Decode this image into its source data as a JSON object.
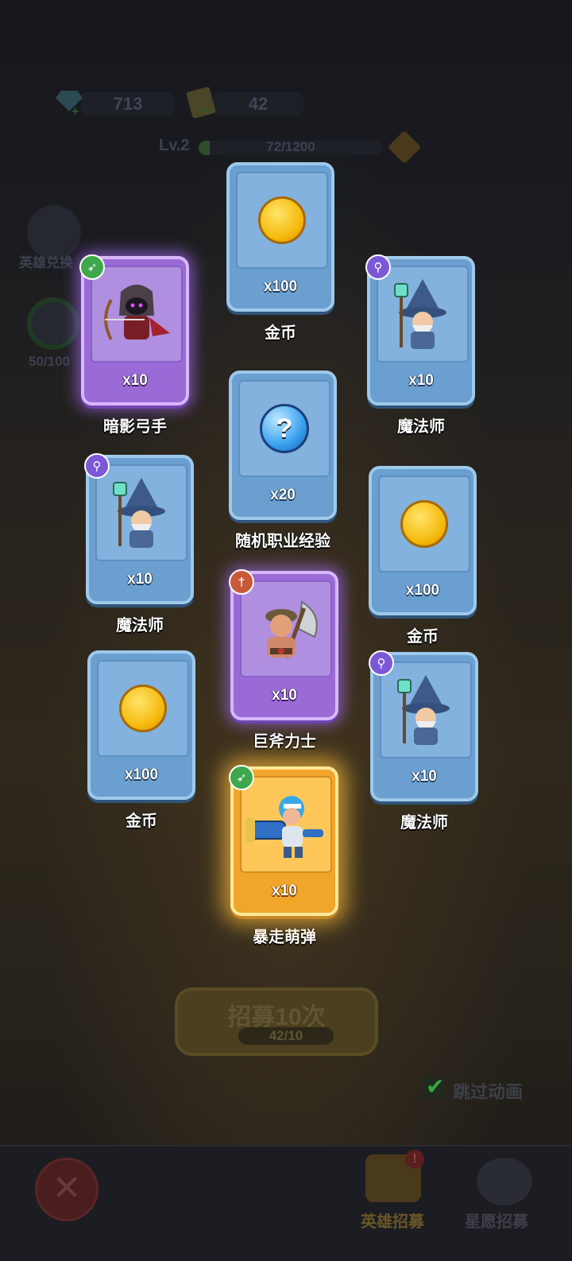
{
  "header": {
    "gems": "713",
    "tickets": "42",
    "level_label": "Lv.2",
    "exp_text": "72/1200",
    "exp_progress": 0.06
  },
  "side": {
    "hero_exchange_label": "英雄兑换",
    "progress_label": "50/100"
  },
  "results": [
    {
      "name": "金币",
      "qty": "x100",
      "rarity": "blue",
      "icon": "gold-coin-icon"
    },
    {
      "name": "暗影弓手",
      "qty": "x10",
      "rarity": "purple",
      "icon": "shadow-archer-icon",
      "class_badge": "bow-icon"
    },
    {
      "name": "魔法师",
      "qty": "x10",
      "rarity": "blue",
      "icon": "wizard-icon",
      "class_badge": "staff-icon"
    },
    {
      "name": "随机职业经验",
      "qty": "x20",
      "rarity": "blue",
      "icon": "mystery-orb-icon",
      "orb_symbol": "?"
    },
    {
      "name": "魔法师",
      "qty": "x10",
      "rarity": "blue",
      "icon": "wizard-icon",
      "class_badge": "staff-icon"
    },
    {
      "name": "金币",
      "qty": "x100",
      "rarity": "blue",
      "icon": "gold-coin-icon"
    },
    {
      "name": "巨斧力士",
      "qty": "x10",
      "rarity": "purple",
      "icon": "axe-warrior-icon",
      "class_badge": "sword-icon"
    },
    {
      "name": "金币",
      "qty": "x100",
      "rarity": "blue",
      "icon": "gold-coin-icon"
    },
    {
      "name": "魔法师",
      "qty": "x10",
      "rarity": "blue",
      "icon": "wizard-icon",
      "class_badge": "staff-icon"
    },
    {
      "name": "暴走萌弹",
      "qty": "x10",
      "rarity": "gold",
      "icon": "cannon-hero-icon",
      "class_badge": "bow-icon"
    }
  ],
  "recruit": {
    "button_label": "招募10次",
    "cost_text": "42/10"
  },
  "skip": {
    "label": "跳过动画",
    "checked": true
  },
  "nav": {
    "tab_hero_recruit": "英雄招募",
    "tab_star_recruit": "星愿招募",
    "close_symbol": "✕"
  },
  "colors": {
    "blue_card": "#6a9fd0",
    "purple_card": "#9a6bd6",
    "gold_card": "#f2a52b",
    "check_green": "#36a83c"
  }
}
